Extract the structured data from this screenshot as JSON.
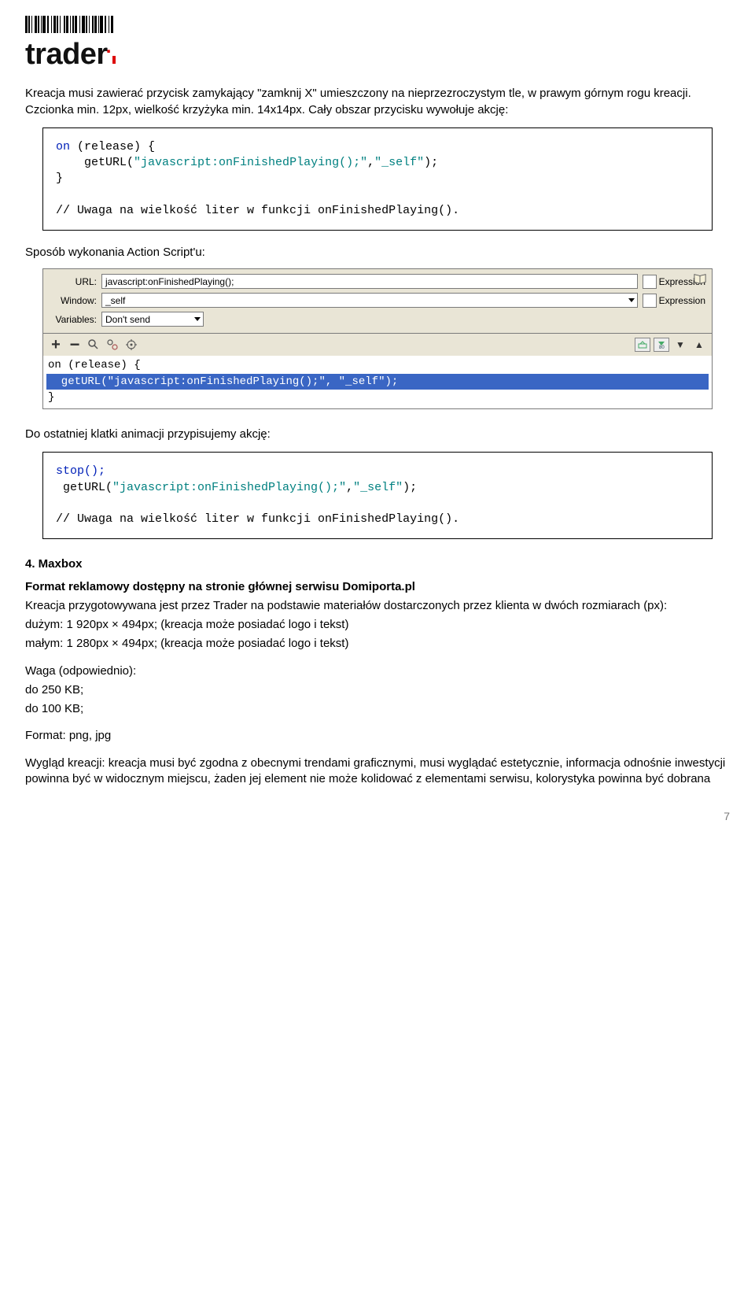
{
  "brand": "trader",
  "intro_paragraph": "Kreacja musi zawierać przycisk zamykający \"zamknij X\" umieszczony na nieprzezroczystym tle, w prawym górnym rogu kreacji. Czcionka min. 12px, wielkość krzyżyka min. 14x14px. Cały obszar przycisku wywołuje akcję:",
  "code1": {
    "l1a": "on",
    "l1b": " (release) {",
    "l2a": "    getURL(",
    "l2b": "\"javascript:onFinishedPlaying();\"",
    "l2c": ",",
    "l2d": "\"_self\"",
    "l2e": ");",
    "l3": "}",
    "l4": "",
    "l5": "// Uwaga na wielkość liter w funkcji onFinishedPlaying()."
  },
  "script_heading": "Sposób wykonania Action Script'u:",
  "ide": {
    "labels": {
      "url": "URL:",
      "window": "Window:",
      "variables": "Variables:"
    },
    "url_value": "javascript:onFinishedPlaying();",
    "window_value": "_self",
    "variables_value": "Don't send",
    "expression_label": "Expression",
    "code": {
      "l1": "on (release) {",
      "l2": "  getURL(\"javascript:onFinishedPlaying();\", \"_self\");",
      "l3": "}"
    }
  },
  "assign_text": "Do ostatniej klatki animacji przypisujemy akcję:",
  "code2": {
    "l1": "stop();",
    "l2a": " getURL(",
    "l2b": "\"javascript:onFinishedPlaying();\"",
    "l2c": ",",
    "l2d": "\"_self\"",
    "l2e": ");",
    "l3": "",
    "l4": "// Uwaga na wielkość liter w funkcji onFinishedPlaying()."
  },
  "maxbox": {
    "heading": "4. Maxbox",
    "line_bold": "Format reklamowy dostępny na stronie głównej serwisu Domiporta.pl",
    "p1": "Kreacja przygotowywana jest przez Trader na podstawie materiałów dostarczonych przez klienta w dwóch rozmiarach (px):",
    "p2": "dużym: 1 920px × 494px; (kreacja może posiadać logo i tekst)",
    "p3": "małym: 1 280px × 494px; (kreacja może posiadać logo i tekst)",
    "w_head": "Waga (odpowiednio):",
    "w1": "do 250 KB;",
    "w2": "do 100 KB;",
    "format": "Format: png, jpg",
    "look": "Wygląd kreacji: kreacja musi być zgodna z obecnymi trendami graficznymi, musi wyglądać estetycznie, informacja odnośnie inwestycji powinna być w widocznym miejscu, żaden jej element nie może kolidować z elementami serwisu, kolorystyka powinna być dobrana"
  },
  "page_number": "7"
}
